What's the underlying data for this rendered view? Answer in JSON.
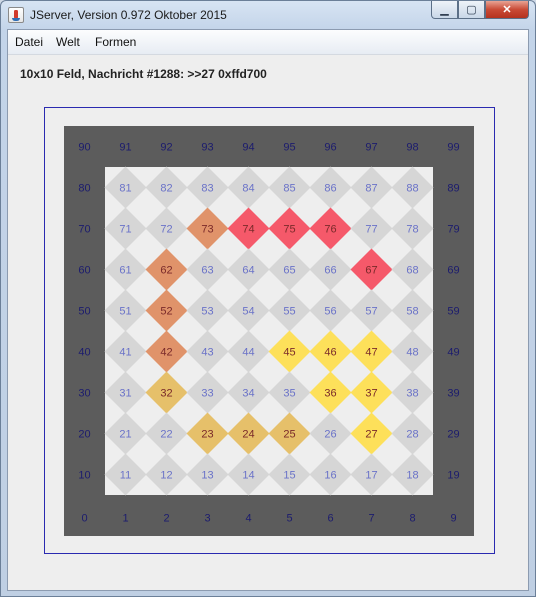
{
  "window": {
    "title": "JServer, Version 0.972 Oktober 2015"
  },
  "menu": {
    "items": [
      "Datei",
      "Welt",
      "Formen"
    ]
  },
  "status": {
    "text": "10x10 Feld, Nachricht #1288: >>27 0xffd700"
  },
  "board": {
    "rows": [
      [
        "90",
        "91",
        "92",
        "93",
        "94",
        "95",
        "96",
        "97",
        "98",
        "99"
      ],
      [
        "80",
        "81",
        "82",
        "83",
        "84",
        "85",
        "86",
        "87",
        "88",
        "89"
      ],
      [
        "70",
        "71",
        "72",
        "73",
        "74",
        "75",
        "76",
        "77",
        "78",
        "79"
      ],
      [
        "60",
        "61",
        "62",
        "63",
        "64",
        "65",
        "66",
        "67",
        "68",
        "69"
      ],
      [
        "50",
        "51",
        "52",
        "53",
        "54",
        "55",
        "56",
        "57",
        "58",
        "59"
      ],
      [
        "40",
        "41",
        "42",
        "43",
        "44",
        "45",
        "46",
        "47",
        "48",
        "49"
      ],
      [
        "30",
        "31",
        "32",
        "33",
        "34",
        "35",
        "36",
        "37",
        "38",
        "39"
      ],
      [
        "20",
        "21",
        "22",
        "23",
        "24",
        "25",
        "26",
        "27",
        "28",
        "29"
      ],
      [
        "10",
        "11",
        "12",
        "13",
        "14",
        "15",
        "16",
        "17",
        "18",
        "19"
      ],
      [
        "0",
        "1",
        "2",
        "3",
        "4",
        "5",
        "6",
        "7",
        "8",
        "9"
      ]
    ],
    "colored": {
      "73": "#e0936a",
      "74": "#f5596a",
      "75": "#f5596a",
      "76": "#f5596a",
      "62": "#e0936a",
      "67": "#f5596a",
      "52": "#e0936a",
      "42": "#e0936a",
      "45": "#fde05a",
      "46": "#fde05a",
      "47": "#fde05a",
      "32": "#e6c06a",
      "36": "#fde05a",
      "37": "#fde05a",
      "23": "#e6c06a",
      "24": "#e6c06a",
      "25": "#e6c06a",
      "27": "#fde05a"
    },
    "default_diamond_color": "#d6d6d6",
    "border_color": "#5c5c5c",
    "inner_bg": "#eeeeee",
    "inner_label_color": "#6a72c8",
    "border_label_color": "#1c1c6e"
  }
}
